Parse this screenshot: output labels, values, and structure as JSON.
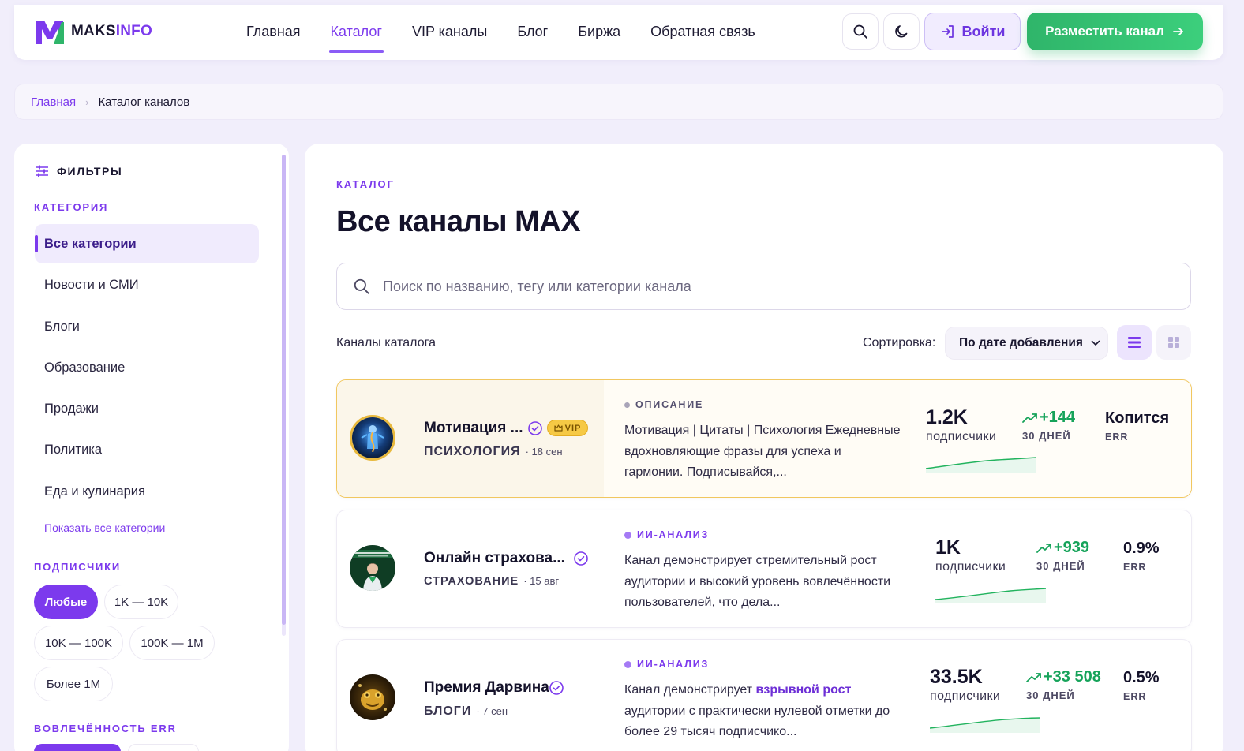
{
  "header": {
    "logo": {
      "prefix": "MAKS",
      "accent": "INFO"
    },
    "nav": [
      {
        "label": "Главная",
        "active": false
      },
      {
        "label": "Каталог",
        "active": true
      },
      {
        "label": "VIP каналы",
        "active": false
      },
      {
        "label": "Блог",
        "active": false
      },
      {
        "label": "Биржа",
        "active": false
      },
      {
        "label": "Обратная связь",
        "active": false
      }
    ],
    "search_icon": "search-icon",
    "theme_icon": "moon-icon",
    "login_label": "Войти",
    "place_channel_label": "Разместить канал"
  },
  "breadcrumb": {
    "home": "Главная",
    "current": "Каталог каналов"
  },
  "sidebar": {
    "title": "ФИЛЬТРЫ",
    "category_label": "КАТЕГОРИЯ",
    "categories": [
      {
        "label": "Все категории",
        "active": true
      },
      {
        "label": "Новости и СМИ",
        "active": false
      },
      {
        "label": "Блоги",
        "active": false
      },
      {
        "label": "Образование",
        "active": false
      },
      {
        "label": "Продажи",
        "active": false
      },
      {
        "label": "Политика",
        "active": false
      },
      {
        "label": "Еда и кулинария",
        "active": false
      }
    ],
    "show_all": "Показать все категории",
    "subscribers_label": "ПОДПИСЧИКИ",
    "subscriber_ranges": [
      {
        "label": "Любые",
        "active": true
      },
      {
        "label": "1K — 10K",
        "active": false
      },
      {
        "label": "10K — 100K",
        "active": false
      },
      {
        "label": "100K — 1M",
        "active": false
      },
      {
        "label": "Более 1M",
        "active": false
      }
    ],
    "engagement_label": "ВОВЛЕЧЁННОСТЬ ERR"
  },
  "main": {
    "eyebrow": "КАТАЛОГ",
    "title": "Все каналы MAX",
    "search_placeholder": "Поиск по названию, тегу или категории канала",
    "list_label": "Каналы каталога",
    "sort_label": "Сортировка:",
    "sort_value": "По дате добавления",
    "view_modes": [
      "list-view-icon",
      "grid-view-icon"
    ],
    "active_view": "list"
  },
  "channels": [
    {
      "name": "Мотивация ...",
      "verified": true,
      "vip": true,
      "vip_label": "VIP",
      "category": "ПСИХОЛОГИЯ",
      "date": "· 18 сен",
      "desc_label": "ОПИСАНИЕ",
      "desc_type": "description",
      "desc": "Мотивация | Цитаты | Психология Ежедневные вдохновляющие фразы для успеха и гармонии. Подписывайся,...",
      "subs": "1.2K",
      "subs_label": "подписчики",
      "growth": "+144",
      "growth_label": "30 ДНЕЙ",
      "err": "Копится",
      "err_label": "ERR"
    },
    {
      "name": "Онлайн страхова...",
      "verified": true,
      "vip": false,
      "category": "СТРАХОВАНИЕ",
      "date": "· 15 авг",
      "desc_label": "ИИ-АНАЛИЗ",
      "desc_type": "ai",
      "desc": "Канал демонстрирует стремительный рост аудитории и высокий уровень вовлечённости пользователей, что дела...",
      "subs": "1K",
      "subs_label": "подписчики",
      "growth": "+939",
      "growth_label": "30 ДНЕЙ",
      "err": "0.9%",
      "err_label": "ERR"
    },
    {
      "name": "Премия Дарвина",
      "verified": true,
      "vip": false,
      "category": "БЛОГИ",
      "date": "· 7 сен",
      "desc_label": "ИИ-АНАЛИЗ",
      "desc_type": "ai",
      "desc_before": "Канал демонстрирует ",
      "desc_highlight": "взрывной рост",
      "desc_after": " аудитории с практически нулевой отметки до более 29 тысяч подписчико...",
      "subs": "33.5K",
      "subs_label": "подписчики",
      "growth": "+33 508",
      "growth_label": "30 ДНЕЙ",
      "err": "0.5%",
      "err_label": "ERR"
    }
  ],
  "colors": {
    "accent": "#7c3aed",
    "cta_green": "#2fb56a",
    "growth_green": "#16a35a",
    "vip_gold": "#f6c945",
    "page_bg": "#f1eefb"
  }
}
